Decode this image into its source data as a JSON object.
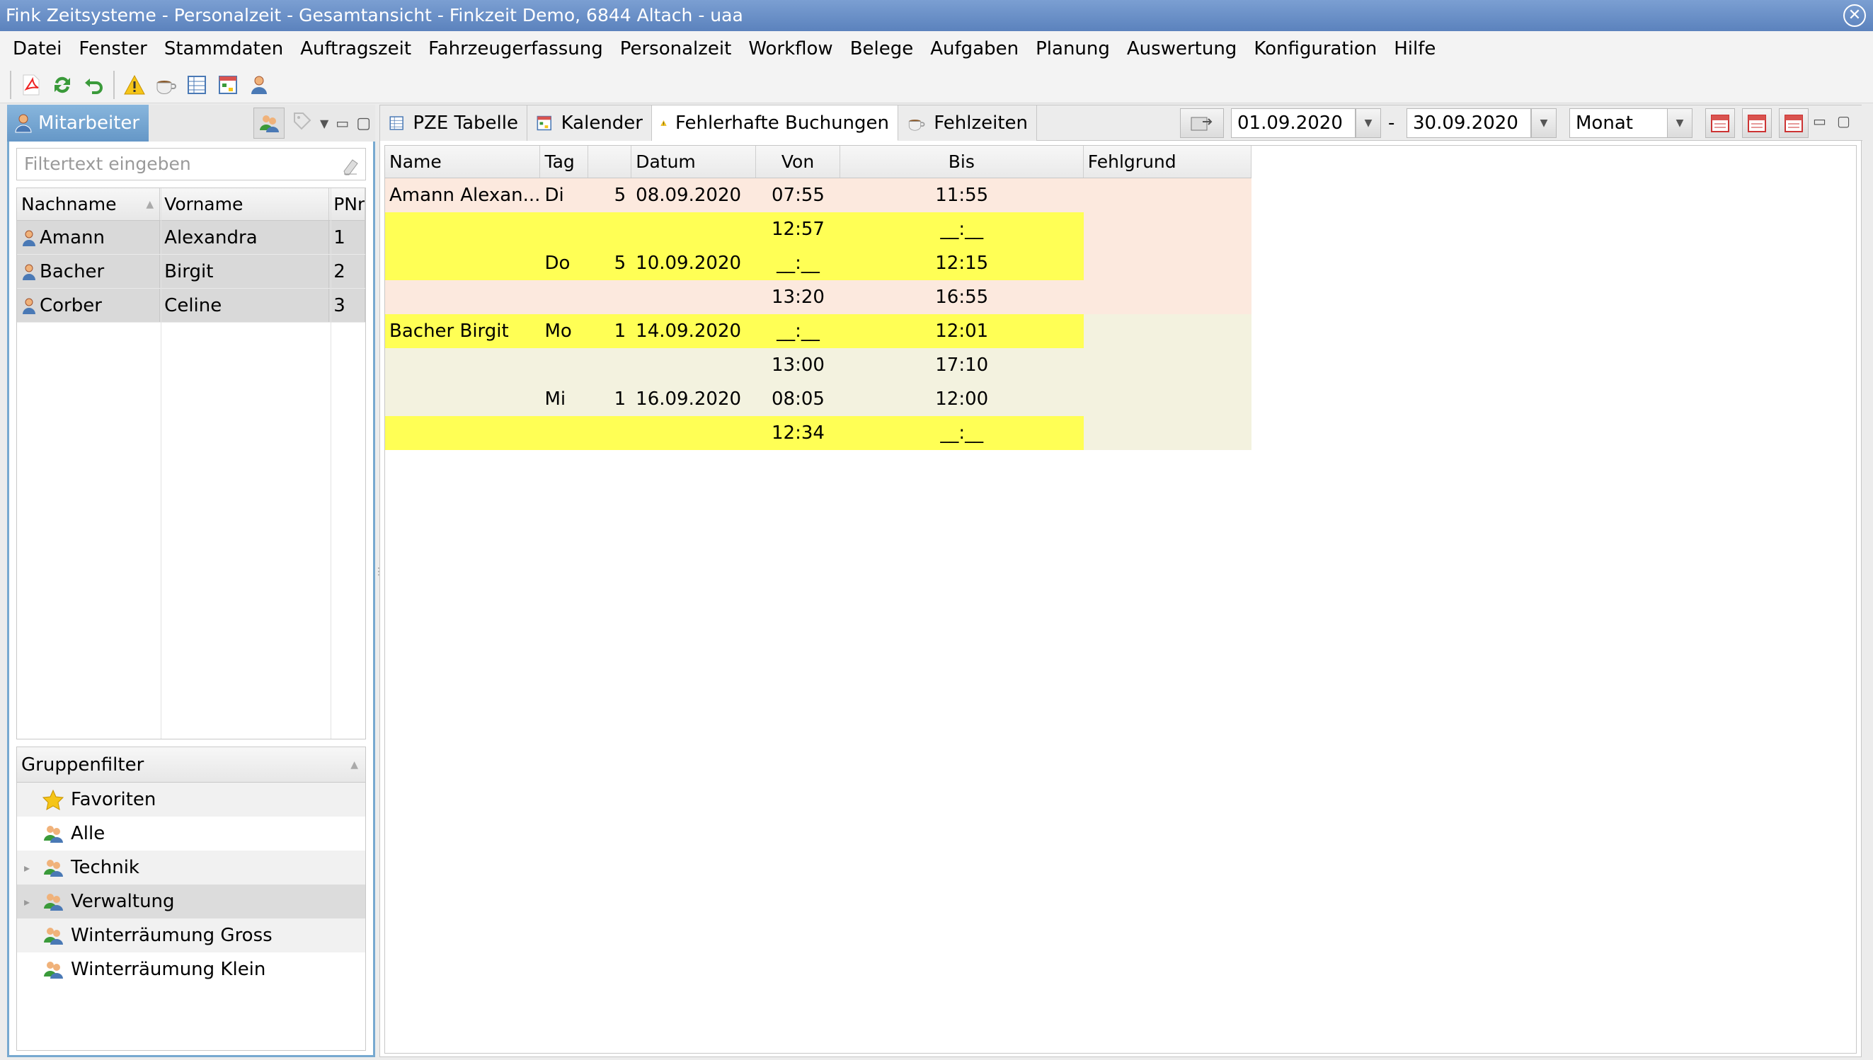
{
  "window": {
    "title": "Fink Zeitsysteme - Personalzeit - Gesamtansicht - Finkzeit Demo, 6844 Altach - uaa"
  },
  "menu": [
    "Datei",
    "Fenster",
    "Stammdaten",
    "Auftragszeit",
    "Fahrzeugerfassung",
    "Personalzeit",
    "Workflow",
    "Belege",
    "Aufgaben",
    "Planung",
    "Auswertung",
    "Konfiguration",
    "Hilfe"
  ],
  "toolbar": {
    "icons": [
      "pdf-icon",
      "refresh-icon",
      "undo-icon",
      "warning-icon",
      "coffee-icon",
      "table-icon",
      "calendar-icon",
      "person-icon"
    ]
  },
  "left": {
    "tab_label": "Mitarbeiter",
    "filter_placeholder": "Filtertext eingeben",
    "columns": [
      "Nachname",
      "Vorname",
      "PNr"
    ],
    "employees": [
      {
        "nachname": "Amann",
        "vorname": "Alexandra",
        "pnr": "1"
      },
      {
        "nachname": "Bacher",
        "vorname": "Birgit",
        "pnr": "2"
      },
      {
        "nachname": "Corber",
        "vorname": "Celine",
        "pnr": "3"
      }
    ],
    "group_header": "Gruppenfilter",
    "groups": [
      {
        "label": "Favoriten",
        "icon": "star-icon",
        "expandable": false
      },
      {
        "label": "Alle",
        "icon": "group-icon",
        "expandable": false
      },
      {
        "label": "Technik",
        "icon": "group-icon",
        "expandable": true
      },
      {
        "label": "Verwaltung",
        "icon": "group-icon",
        "expandable": true
      },
      {
        "label": "Winterräumung Gross",
        "icon": "group-icon",
        "expandable": false
      },
      {
        "label": "Winterräumung Klein",
        "icon": "group-icon",
        "expandable": false
      }
    ]
  },
  "right": {
    "tabs": [
      {
        "label": "PZE Tabelle",
        "icon": "table-icon"
      },
      {
        "label": "Kalender",
        "icon": "calendar-icon"
      },
      {
        "label": "Fehlerhafte Buchungen",
        "icon": "warning-icon"
      },
      {
        "label": "Fehlzeiten",
        "icon": "coffee-icon"
      }
    ],
    "active_tab": "Fehlerhafte Buchungen",
    "date_from": "01.09.2020",
    "date_separator": "-",
    "date_to": "30.09.2020",
    "period": "Monat",
    "columns": [
      "Name",
      "Tag",
      "",
      "Datum",
      "Von",
      "Bis",
      "Fehlgrund"
    ],
    "rows": [
      {
        "name": "Amann Alexan...",
        "tag": "Di",
        "nr": "5",
        "datum": "08.09.2020",
        "von": "07:55",
        "bis": "11:55",
        "fehlgrund": "",
        "highlight": false,
        "group": "a"
      },
      {
        "name": "",
        "tag": "",
        "nr": "",
        "datum": "",
        "von": "12:57",
        "bis": "__:__",
        "fehlgrund": "",
        "highlight": true,
        "group": "a"
      },
      {
        "name": "",
        "tag": "Do",
        "nr": "5",
        "datum": "10.09.2020",
        "von": "__:__",
        "bis": "12:15",
        "fehlgrund": "",
        "highlight": true,
        "group": "a"
      },
      {
        "name": "",
        "tag": "",
        "nr": "",
        "datum": "",
        "von": "13:20",
        "bis": "16:55",
        "fehlgrund": "",
        "highlight": false,
        "group": "a"
      },
      {
        "name": "Bacher Birgit",
        "tag": "Mo",
        "nr": "1",
        "datum": "14.09.2020",
        "von": "__:__",
        "bis": "12:01",
        "fehlgrund": "",
        "highlight": true,
        "group": "b"
      },
      {
        "name": "",
        "tag": "",
        "nr": "",
        "datum": "",
        "von": "13:00",
        "bis": "17:10",
        "fehlgrund": "",
        "highlight": false,
        "group": "b"
      },
      {
        "name": "",
        "tag": "Mi",
        "nr": "1",
        "datum": "16.09.2020",
        "von": "08:05",
        "bis": "12:00",
        "fehlgrund": "",
        "highlight": false,
        "group": "b"
      },
      {
        "name": "",
        "tag": "",
        "nr": "",
        "datum": "",
        "von": "12:34",
        "bis": "__:__",
        "fehlgrund": "",
        "highlight": true,
        "group": "b"
      }
    ]
  },
  "colors": {
    "highlight": "#ffff55",
    "group_a": "#fce9de",
    "group_b": "#f3f2df",
    "accent": "#6597c7"
  }
}
